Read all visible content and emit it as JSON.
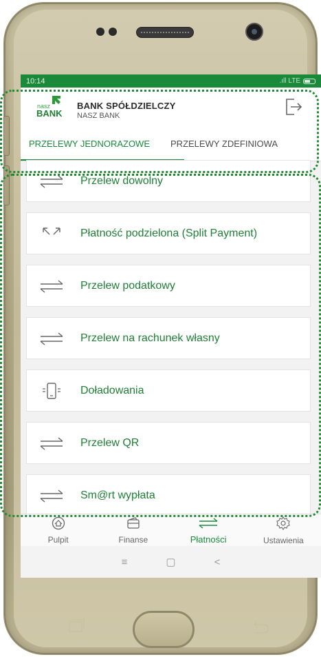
{
  "status_bar": {
    "time": "10:14",
    "network": ".ıll LTE"
  },
  "header": {
    "logo_line1": "nasz",
    "logo_line2": "BANK",
    "bank_name": "BANK SPÓŁDZIELCZY",
    "bank_subtitle": "NASZ BANK"
  },
  "tabs": [
    {
      "label": "PRZELEWY JEDNORAZOWE",
      "active": true
    },
    {
      "label": "PRZELEWY ZDEFINIOWA",
      "active": false
    }
  ],
  "menu_items": [
    {
      "label": "Przelew dowolny",
      "icon": "transfer-arrows-icon"
    },
    {
      "label": "Płatność podzielona (Split Payment)",
      "icon": "split-arrows-icon"
    },
    {
      "label": "Przelew podatkowy",
      "icon": "transfer-arrows-icon"
    },
    {
      "label": "Przelew na rachunek własny",
      "icon": "transfer-arrows-icon"
    },
    {
      "label": "Doładowania",
      "icon": "phone-topup-icon"
    },
    {
      "label": "Przelew QR",
      "icon": "transfer-arrows-icon"
    },
    {
      "label": "Sm@rt wypłata",
      "icon": "transfer-arrows-icon"
    }
  ],
  "bottom_nav": [
    {
      "label": "Pulpit",
      "icon": "home-icon",
      "active": false
    },
    {
      "label": "Finanse",
      "icon": "wallet-icon",
      "active": false
    },
    {
      "label": "Płatności",
      "icon": "transfer-arrows-icon",
      "active": true
    },
    {
      "label": "Ustawienia",
      "icon": "gear-icon",
      "active": false
    }
  ],
  "system_nav": {
    "menu": "≡",
    "home": "▢",
    "back": "<"
  },
  "colors": {
    "brand_green": "#1a8a3a",
    "text_green": "#1f7f35",
    "highlight_dotted": "#1f8a30"
  }
}
